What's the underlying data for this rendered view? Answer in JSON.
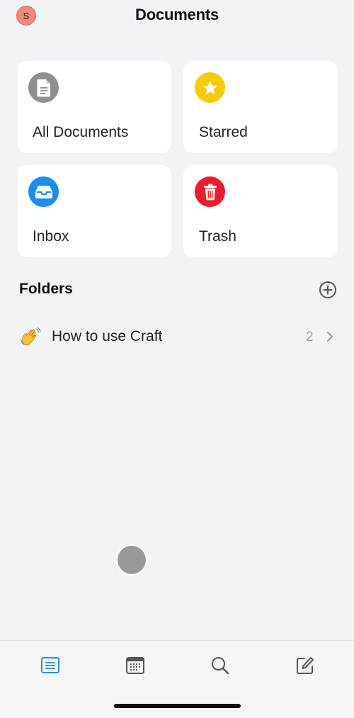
{
  "header": {
    "avatar_initial": "S",
    "title": "Documents"
  },
  "cards": {
    "all_documents": {
      "label": "All Documents",
      "icon": "document-icon",
      "color": "#8e8e93"
    },
    "starred": {
      "label": "Starred",
      "icon": "star-icon",
      "color": "#f5cc0a"
    },
    "inbox": {
      "label": "Inbox",
      "icon": "inbox-tray-icon",
      "color": "#1b8cf0"
    },
    "trash": {
      "label": "Trash",
      "icon": "trash-icon",
      "color": "#ec1c2e"
    }
  },
  "folders": {
    "heading": "Folders",
    "add_icon": "plus-circle-icon",
    "items": [
      {
        "emoji_icon": "waving-hand-icon",
        "name": "How to use Craft",
        "count": "2"
      }
    ]
  },
  "tabbar": {
    "items": [
      {
        "icon": "documents-tab-icon",
        "active": true,
        "color": "#2a8fd8"
      },
      {
        "icon": "calendar-icon",
        "active": false
      },
      {
        "icon": "search-icon",
        "active": false
      },
      {
        "icon": "compose-icon",
        "active": false
      }
    ]
  }
}
